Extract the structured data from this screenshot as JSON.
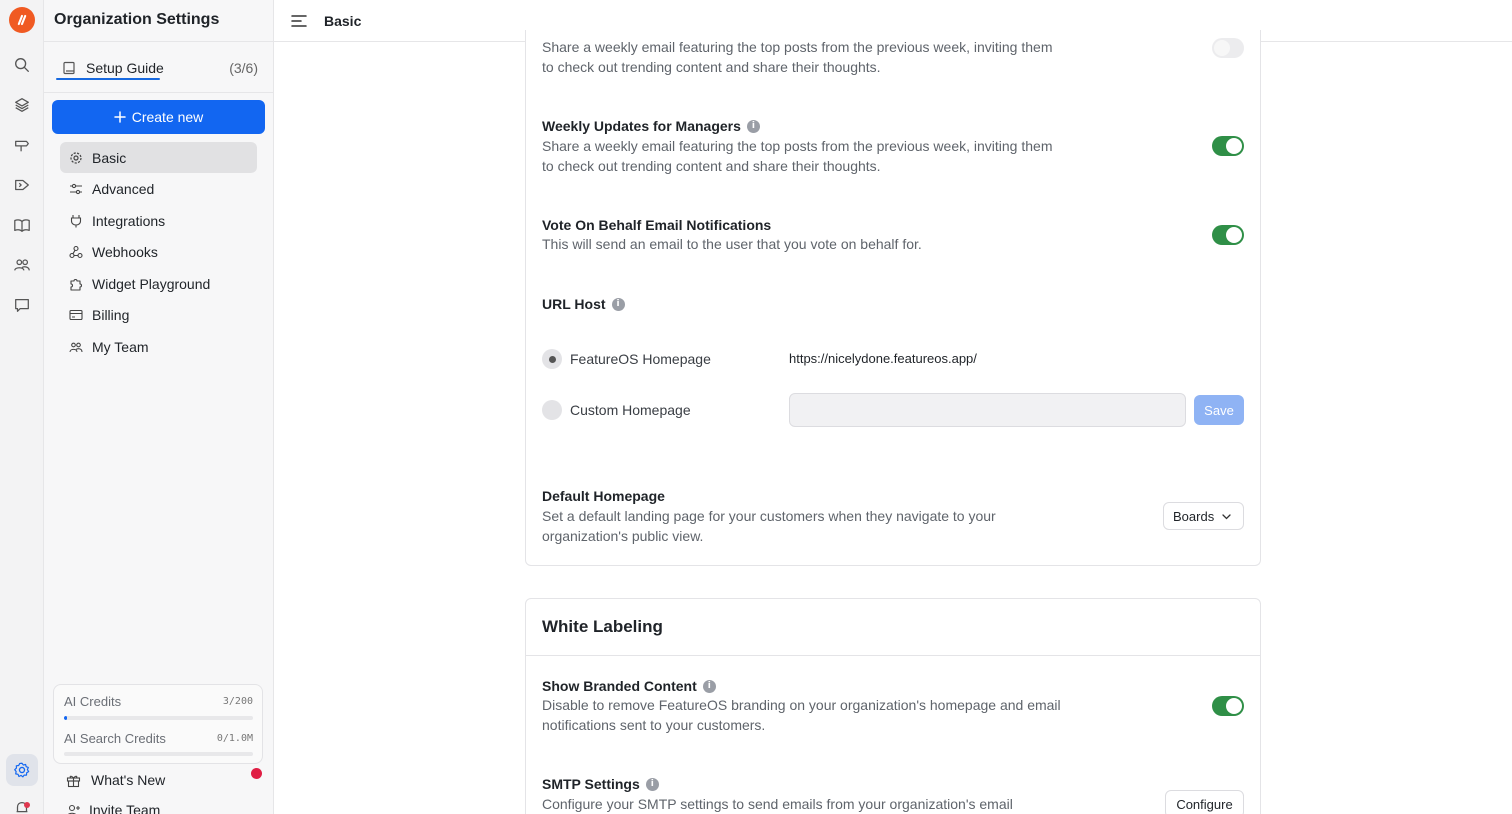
{
  "sidebar": {
    "title": "Organization Settings",
    "setup_guide": {
      "label": "Setup Guide",
      "count": "(3/6)"
    },
    "create_label": "Create new",
    "items": [
      {
        "label": "Basic",
        "icon": "gear-icon",
        "active": true
      },
      {
        "label": "Advanced",
        "icon": "sliders-icon"
      },
      {
        "label": "Integrations",
        "icon": "plug-icon"
      },
      {
        "label": "Webhooks",
        "icon": "webhook-icon"
      },
      {
        "label": "Widget Playground",
        "icon": "puzzle-icon"
      },
      {
        "label": "Billing",
        "icon": "billing-icon"
      },
      {
        "label": "My Team",
        "icon": "team-icon"
      }
    ],
    "credits": [
      {
        "label": "AI Credits",
        "value": "3/200",
        "fraction": 0.015
      },
      {
        "label": "AI Search Credits",
        "value": "0/1.0M",
        "fraction": 0
      }
    ],
    "whats_new": "What's New",
    "invite_team": "Invite Team"
  },
  "topbar": {
    "breadcrumb": "Basic"
  },
  "settings": {
    "weekly_top_posts": {
      "desc": "Share a weekly email featuring the top posts from the previous week, inviting them to check out trending content and share their thoughts.",
      "enabled": false
    },
    "weekly_managers": {
      "title": "Weekly Updates for Managers",
      "desc": "Share a weekly email featuring the top posts from the previous week, inviting them to check out trending content and share their thoughts.",
      "enabled": true
    },
    "vote_behalf": {
      "title": "Vote On Behalf Email Notifications",
      "desc": "This will send an email to the user that you vote on behalf for.",
      "enabled": true
    },
    "url_host": {
      "title": "URL Host",
      "option_featureos": "FeatureOS Homepage",
      "featureos_url": "https://nicelydone.featureos.app/",
      "option_custom": "Custom Homepage",
      "custom_value": "",
      "save_label": "Save"
    },
    "default_homepage": {
      "title": "Default Homepage",
      "desc": "Set a default landing page for your customers when they navigate to your organization's public view.",
      "selected": "Boards"
    }
  },
  "white_labeling": {
    "title": "White Labeling",
    "branded": {
      "title": "Show Branded Content",
      "desc": "Disable to remove FeatureOS branding on your organization's homepage and email notifications sent to your customers.",
      "enabled": true
    },
    "smtp": {
      "title": "SMTP Settings",
      "desc": "Configure your SMTP settings to send emails from your organization's email",
      "button_label": "Configure"
    }
  },
  "colors": {
    "accent": "#1266f1",
    "toggle_on": "#2f8f47",
    "brand": "#f05a22",
    "alert": "#e01e44"
  }
}
